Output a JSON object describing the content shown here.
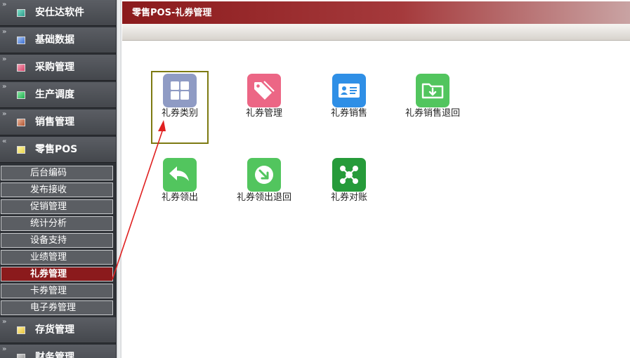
{
  "sidebar": {
    "top_items": [
      {
        "label": "安仕达软件",
        "icon": "teal-square-icon",
        "color": "#2d9b8a"
      },
      {
        "label": "基础数据",
        "icon": "blue-square-icon",
        "color": "#3c6fd1"
      },
      {
        "label": "采购管理",
        "icon": "pink-square-icon",
        "color": "#d9446b"
      },
      {
        "label": "生产调度",
        "icon": "green-square-icon",
        "color": "#1fb04f"
      },
      {
        "label": "销售管理",
        "icon": "brown-square-icon",
        "color": "#b0532f"
      },
      {
        "label": "零售POS",
        "icon": "yellow-square-icon",
        "color": "#e8d54a"
      }
    ],
    "sub_items": [
      "后台编码",
      "发布接收",
      "促销管理",
      "统计分析",
      "设备支持",
      "业绩管理",
      "礼券管理",
      "卡券管理",
      "电子券管理"
    ],
    "active_sub_item": "礼券管理",
    "bottom_items": [
      {
        "label": "存货管理",
        "icon": "yellow-square-icon",
        "color": "#e8c43a"
      },
      {
        "label": "财务管理",
        "icon": "gray-square-icon",
        "color": "#8a8a8a"
      }
    ],
    "expand_glyph": "»",
    "collapse_glyph": "«"
  },
  "header": {
    "title": "零售POS-礼券管理"
  },
  "tiles": [
    {
      "label": "礼券类别",
      "icon": "grid-icon",
      "color": "#8f9bc4"
    },
    {
      "label": "礼券管理",
      "icon": "tag-icon",
      "color": "#ec6685"
    },
    {
      "label": "礼券销售",
      "icon": "id-card-icon",
      "color": "#2f8fe6"
    },
    {
      "label": "礼券销售退回",
      "icon": "folder-return-icon",
      "color": "#52c55e"
    },
    {
      "label": "礼券领出",
      "icon": "reply-arrow-icon",
      "color": "#52c55e"
    },
    {
      "label": "礼券领出退回",
      "icon": "down-right-arrow-icon",
      "color": "#52c55e"
    },
    {
      "label": "礼券对账",
      "icon": "network-icon",
      "color": "#269b3a"
    }
  ],
  "annotation": {
    "arrow_color": "#e02020",
    "box_color": "#7d7a12"
  }
}
